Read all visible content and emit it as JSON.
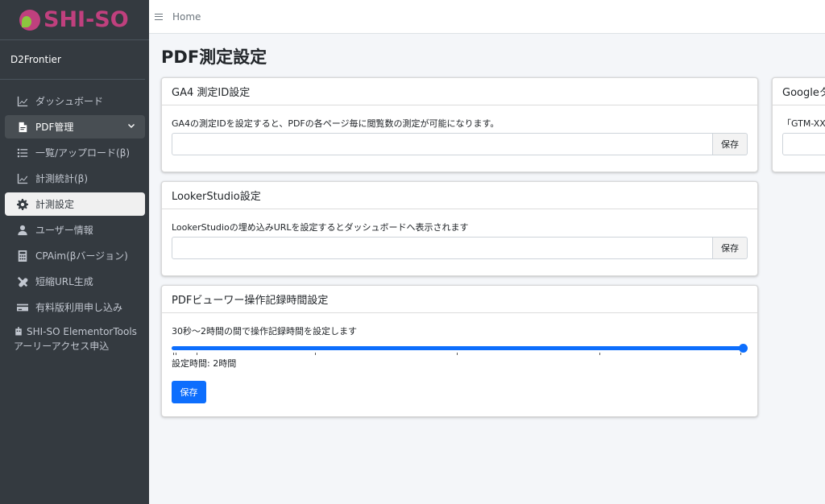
{
  "brand": {
    "logo_text": "SHI-SO"
  },
  "user": {
    "name": "D2Frontier"
  },
  "sidebar": {
    "items": [
      {
        "label": "ダッシュボード",
        "icon": "chart-line-icon"
      },
      {
        "label": "PDF管理",
        "icon": "file-pdf-icon"
      },
      {
        "label": "一覧/アップロード(β)",
        "icon": "list-icon"
      },
      {
        "label": "計測統計(β)",
        "icon": "chart-line-icon"
      },
      {
        "label": "計測設定",
        "icon": "gear-icon"
      },
      {
        "label": "ユーザー情報",
        "icon": "user-icon"
      },
      {
        "label": "CPAim(βバージョン)",
        "icon": "calculator-icon"
      },
      {
        "label": "短縮URL生成",
        "icon": "tools-icon"
      },
      {
        "label": "有料版利用申し込み",
        "icon": "credit-card-icon"
      },
      {
        "label_line1": "SHI-SO ElementorTools",
        "label_line2": "アーリーアクセス申込",
        "icon": "robot-icon"
      }
    ]
  },
  "topbar": {
    "home": "Home"
  },
  "page": {
    "title": "PDF測定設定"
  },
  "ga4": {
    "header": "GA4 測定ID設定",
    "description": "GA4の測定IDを設定すると、PDFの各ページ毎に閲覧数の測定が可能になります。",
    "input_value": "",
    "save_label": "保存"
  },
  "looker": {
    "header": "LookerStudio設定",
    "description": "LookerStudioの埋め込みURLを設定するとダッシュボードへ表示されます",
    "input_value": "",
    "save_label": "保存"
  },
  "viewer": {
    "header": "PDFビューワー操作記録時間設定",
    "description": "30秒～2時間の間で操作記録時間を設定します",
    "slider_value_fraction": 1.0,
    "setting_text": "設定時間: 2時間",
    "save_label": "保存"
  },
  "google_tag": {
    "header": "Googleタ",
    "description": "「GTM-XXX"
  },
  "colors": {
    "sidebar_bg": "#343a40",
    "primary": "#0d6efd",
    "brand_pink": "#c0407e",
    "brand_green": "#8cc63f"
  }
}
